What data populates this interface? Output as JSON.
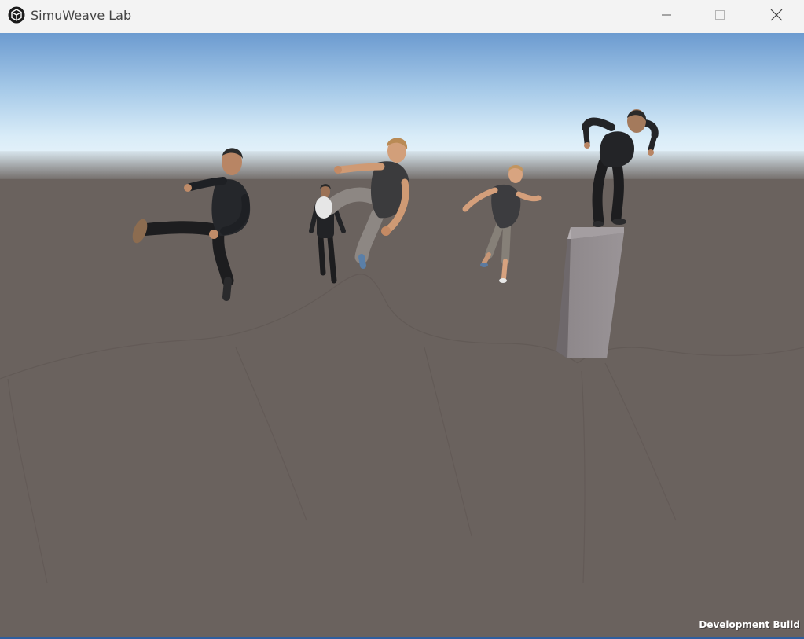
{
  "window": {
    "title": "SimuWeave Lab",
    "app_icon": "unity-cube-icon",
    "controls": {
      "minimize": "minimize-icon",
      "maximize": "maximize-icon",
      "close": "close-icon"
    }
  },
  "viewport": {
    "overlay_label": "Development Build"
  },
  "colors": {
    "titlebar": "#f3f3f3",
    "sky_top": "#6f9fd3",
    "sky_horizon": "#dceefa",
    "ground": "#6a625e",
    "pillar": "#8b8589",
    "suit": "#1f1f21",
    "shirt": "#3a3a3c",
    "skin": "#c9956e"
  }
}
